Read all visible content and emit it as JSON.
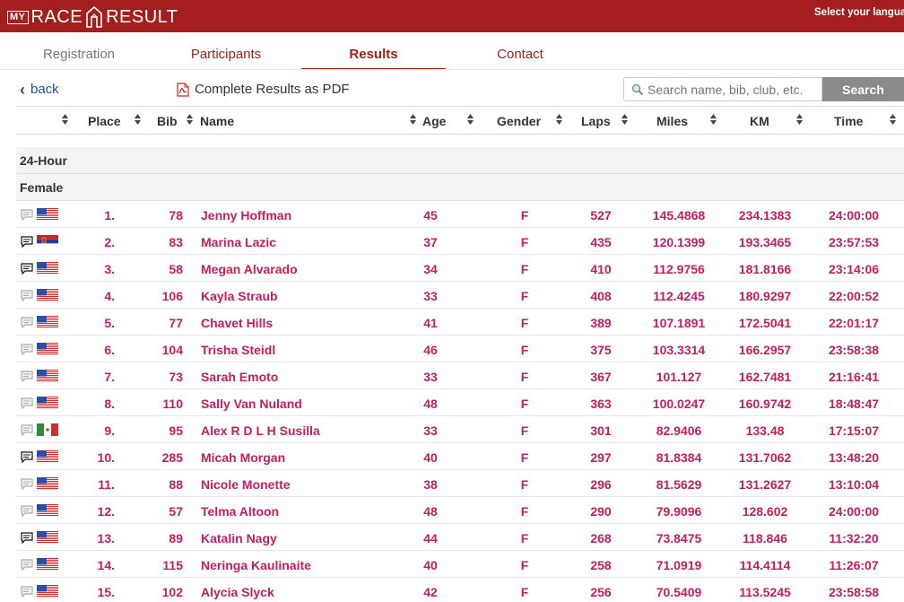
{
  "brand": {
    "my": "MY",
    "race": "RACE",
    "result": "RESULT"
  },
  "language_select": "Select your language",
  "nav": {
    "tabs": [
      "Registration",
      "Participants",
      "Results",
      "Contact"
    ],
    "active": "Results"
  },
  "toolbar": {
    "back_label": "back",
    "pdf_label": "Complete Results as PDF",
    "search_placeholder": "Search name, bib, club, etc.",
    "search_button": "Search"
  },
  "columns": [
    "Place",
    "Bib",
    "Name",
    "Age",
    "Gender",
    "Laps",
    "Miles",
    "KM",
    "Time"
  ],
  "groups": {
    "race": "24-Hour",
    "category": "Female"
  },
  "colors": {
    "brand_red": "#a41e1e",
    "result_pink": "#c41e5c",
    "link_blue": "#1f4e9b"
  },
  "rows": [
    {
      "place": "1.",
      "bib": "78",
      "name": "Jenny Hoffman",
      "age": "45",
      "gender": "F",
      "laps": "527",
      "miles": "145.4868",
      "km": "234.1383",
      "time": "24:00:00",
      "flag": "us",
      "comment": false
    },
    {
      "place": "2.",
      "bib": "83",
      "name": "Marina Lazic",
      "age": "37",
      "gender": "F",
      "laps": "435",
      "miles": "120.1399",
      "km": "193.3465",
      "time": "23:57:53",
      "flag": "rs",
      "comment": true
    },
    {
      "place": "3.",
      "bib": "58",
      "name": "Megan Alvarado",
      "age": "34",
      "gender": "F",
      "laps": "410",
      "miles": "112.9756",
      "km": "181.8166",
      "time": "23:14:06",
      "flag": "us",
      "comment": true
    },
    {
      "place": "4.",
      "bib": "106",
      "name": "Kayla Straub",
      "age": "33",
      "gender": "F",
      "laps": "408",
      "miles": "112.4245",
      "km": "180.9297",
      "time": "22:00:52",
      "flag": "us",
      "comment": false
    },
    {
      "place": "5.",
      "bib": "77",
      "name": "Chavet Hills",
      "age": "41",
      "gender": "F",
      "laps": "389",
      "miles": "107.1891",
      "km": "172.5041",
      "time": "22:01:17",
      "flag": "us",
      "comment": false
    },
    {
      "place": "6.",
      "bib": "104",
      "name": "Trisha Steidl",
      "age": "46",
      "gender": "F",
      "laps": "375",
      "miles": "103.3314",
      "km": "166.2957",
      "time": "23:58:38",
      "flag": "us",
      "comment": false
    },
    {
      "place": "7.",
      "bib": "73",
      "name": "Sarah Emoto",
      "age": "33",
      "gender": "F",
      "laps": "367",
      "miles": "101.127",
      "km": "162.7481",
      "time": "21:16:41",
      "flag": "us",
      "comment": false
    },
    {
      "place": "8.",
      "bib": "110",
      "name": "Sally Van Nuland",
      "age": "48",
      "gender": "F",
      "laps": "363",
      "miles": "100.0247",
      "km": "160.9742",
      "time": "18:48:47",
      "flag": "us",
      "comment": false
    },
    {
      "place": "9.",
      "bib": "95",
      "name": "Alex R D L H Susilla",
      "age": "33",
      "gender": "F",
      "laps": "301",
      "miles": "82.9406",
      "km": "133.48",
      "time": "17:15:07",
      "flag": "mx",
      "comment": false
    },
    {
      "place": "10.",
      "bib": "285",
      "name": "Micah Morgan",
      "age": "40",
      "gender": "F",
      "laps": "297",
      "miles": "81.8384",
      "km": "131.7062",
      "time": "13:48:20",
      "flag": "us",
      "comment": true
    },
    {
      "place": "11.",
      "bib": "88",
      "name": "Nicole Monette",
      "age": "38",
      "gender": "F",
      "laps": "296",
      "miles": "81.5629",
      "km": "131.2627",
      "time": "13:10:04",
      "flag": "us",
      "comment": false
    },
    {
      "place": "12.",
      "bib": "57",
      "name": "Telma Altoon",
      "age": "48",
      "gender": "F",
      "laps": "290",
      "miles": "79.9096",
      "km": "128.602",
      "time": "24:00:00",
      "flag": "us",
      "comment": false
    },
    {
      "place": "13.",
      "bib": "89",
      "name": "Katalin Nagy",
      "age": "44",
      "gender": "F",
      "laps": "268",
      "miles": "73.8475",
      "km": "118.846",
      "time": "11:32:20",
      "flag": "us",
      "comment": true
    },
    {
      "place": "14.",
      "bib": "115",
      "name": "Neringa Kaulinaite",
      "age": "40",
      "gender": "F",
      "laps": "258",
      "miles": "71.0919",
      "km": "114.4114",
      "time": "11:26:07",
      "flag": "us",
      "comment": false
    },
    {
      "place": "15.",
      "bib": "102",
      "name": "Alycia Slyck",
      "age": "42",
      "gender": "F",
      "laps": "256",
      "miles": "70.5409",
      "km": "113.5245",
      "time": "23:58:58",
      "flag": "us",
      "comment": false
    }
  ]
}
